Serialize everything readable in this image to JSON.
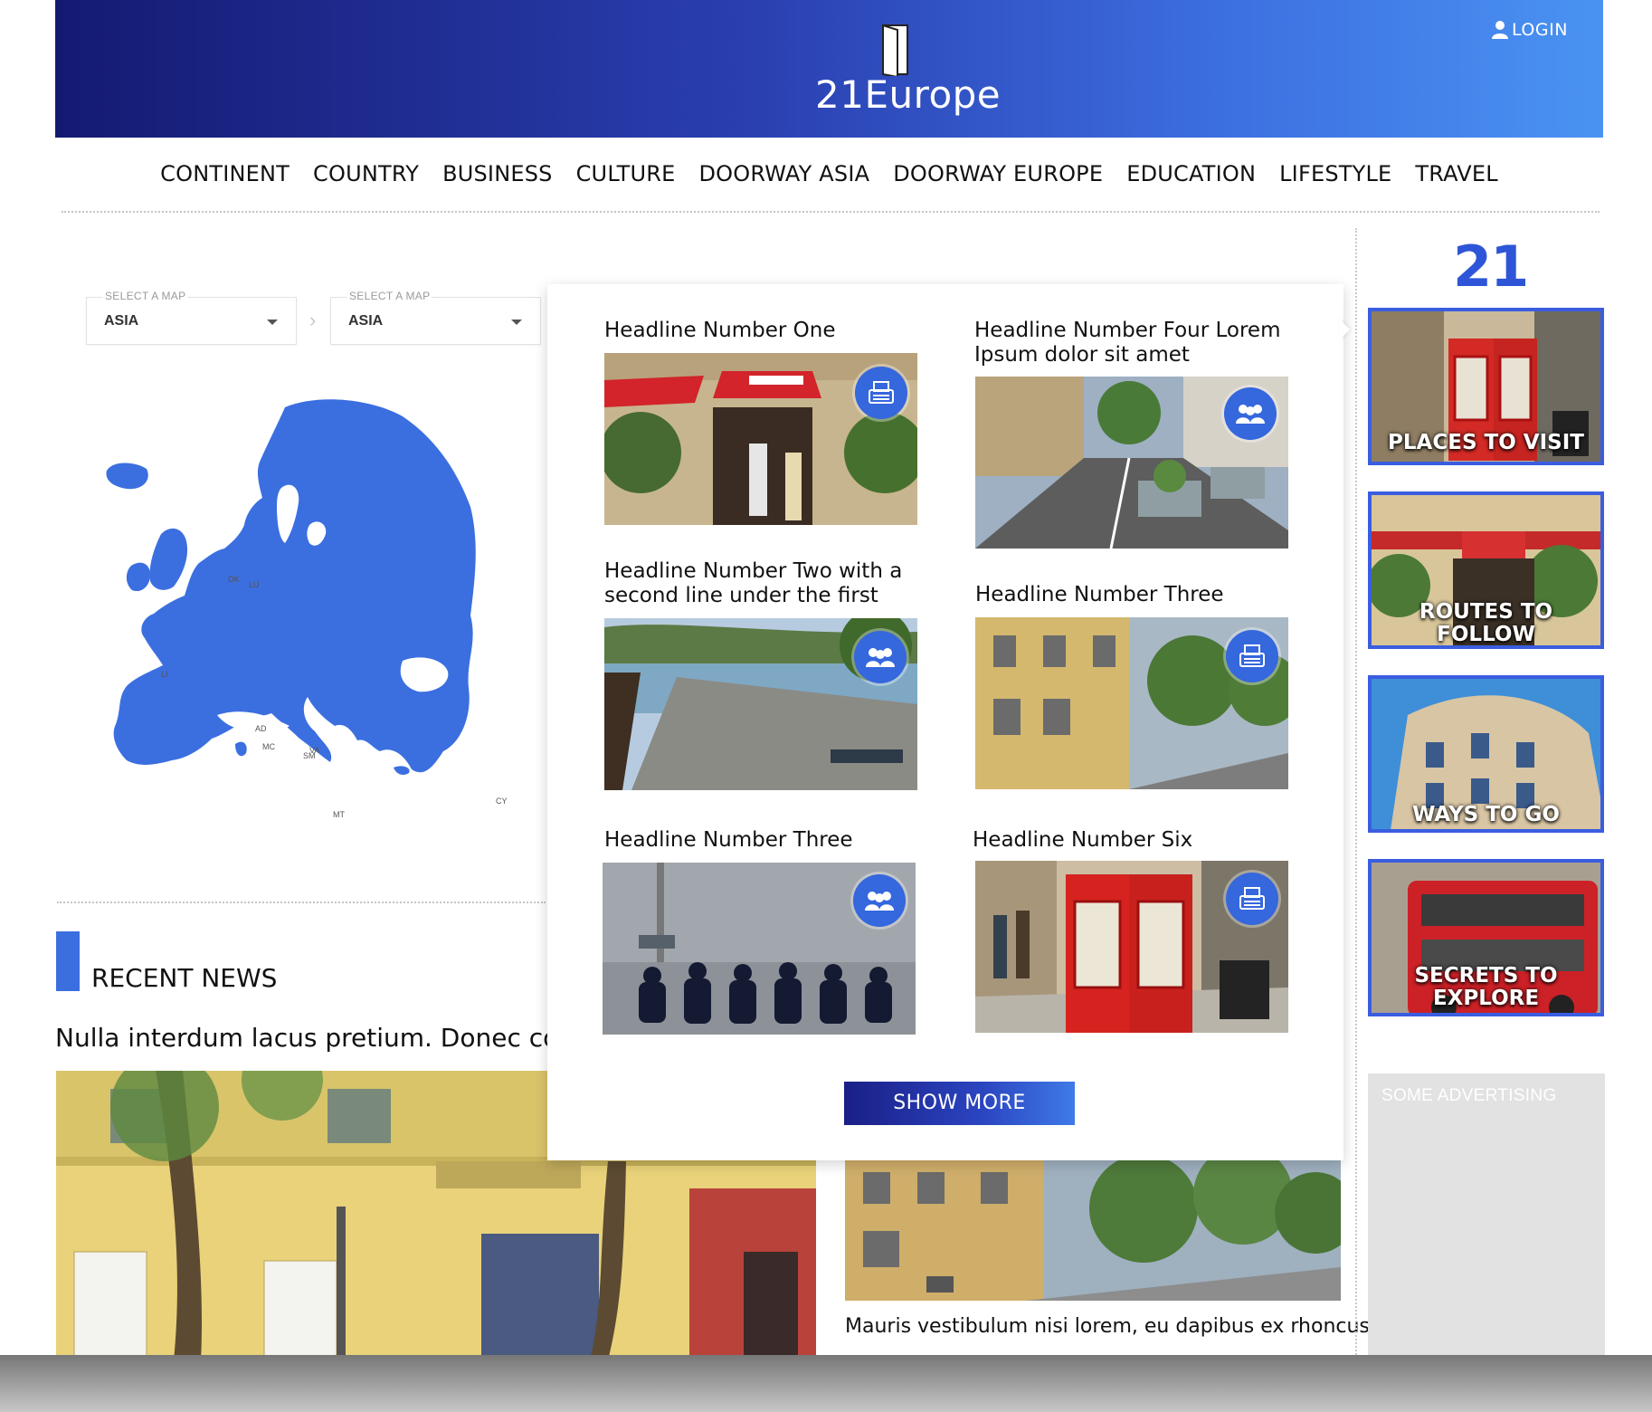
{
  "header": {
    "logo_text": "21Europe",
    "login_label": "LOGIN",
    "icons": [
      "door-logo-icon",
      "user-icon",
      "search-icon"
    ]
  },
  "nav": {
    "items": [
      "CONTINENT",
      "COUNTRY",
      "BUSINESS",
      "CULTURE",
      "DOORWAY ASIA",
      "DOORWAY EUROPE",
      "EDUCATION",
      "LIFESTYLE",
      "TRAVEL"
    ]
  },
  "map_selectors": [
    {
      "label": "SELECT A MAP",
      "value": "ASIA"
    },
    {
      "label": "SELECT A MAP",
      "value": "ASIA"
    }
  ],
  "map": {
    "labels": [
      "DK",
      "LU",
      "LI",
      "AD",
      "MC",
      "SM",
      "VA",
      "MT",
      "CY"
    ]
  },
  "dropdown": {
    "cards": [
      {
        "title": "Headline Number One",
        "badge": "typewriter-icon"
      },
      {
        "title": "Headline Number Four Lorem Ipsum dolor sit amet",
        "badge": "group-icon"
      },
      {
        "title": "Headline Number Two with a second line under the first",
        "badge": "group-icon"
      },
      {
        "title": "Headline Number Three",
        "badge": "typewriter-icon"
      },
      {
        "title": "Headline Number Three",
        "badge": "group-icon"
      },
      {
        "title": "Headline Number Six",
        "badge": "typewriter-icon"
      }
    ],
    "show_more_label": "SHOW MORE"
  },
  "recent_news": {
    "title": "RECENT NEWS",
    "headline": "Nulla interdum lacus pretium. Donec co",
    "secondary_text": "Mauris vestibulum nisi lorem, eu dapibus ex rhoncus"
  },
  "sidebar": {
    "logo": "21",
    "tiles": [
      "PLACES TO VISIT",
      "ROUTES TO FOLLOW",
      "WAYS TO GO",
      "SECRETS TO EXPLORE"
    ],
    "advertising_label": "SOME ADVERTISING"
  },
  "colors": {
    "brand_blue": "#3b6fe0",
    "header_dark": "#141a72",
    "header_light": "#4a93f2"
  }
}
